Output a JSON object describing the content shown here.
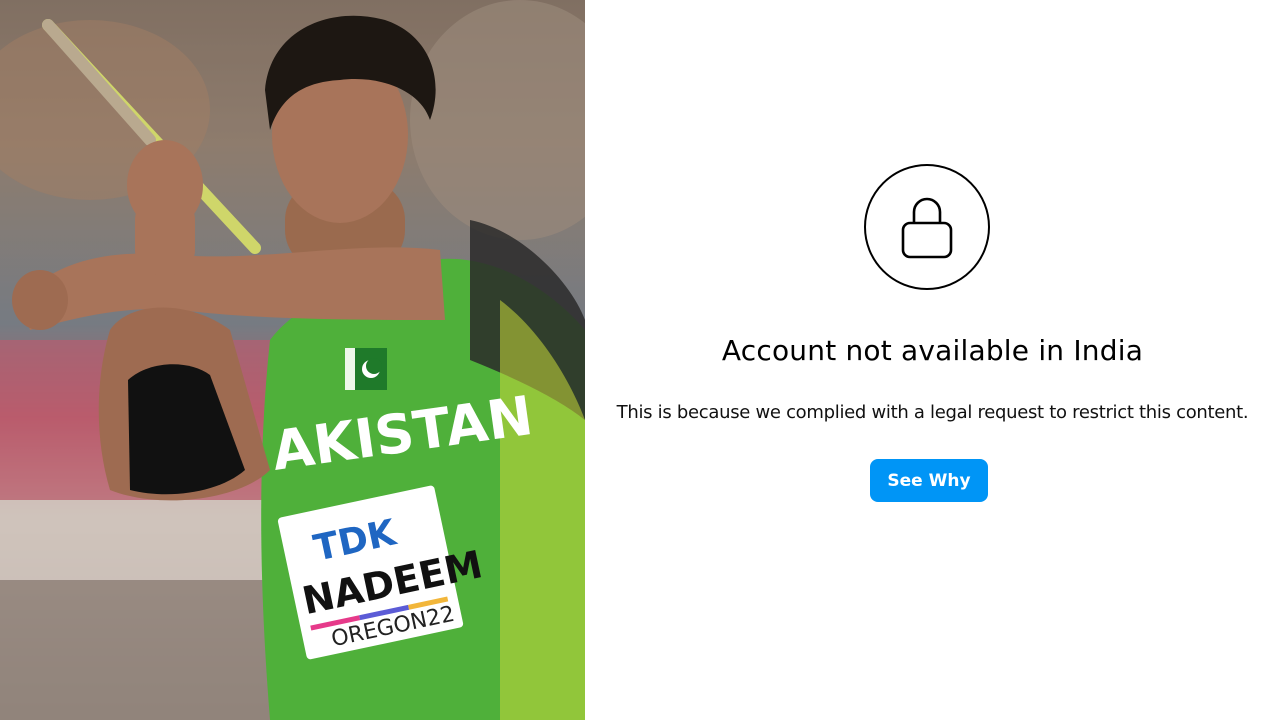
{
  "photo": {
    "jersey_text": "AKISTAN",
    "bib_sponsor": "TDK",
    "bib_name": "NADEEM",
    "bib_event": "OREGON22"
  },
  "notice": {
    "icon": "lock-icon",
    "title": "Account not available in India",
    "description": "This is because we complied with a legal request to restrict this content.",
    "button_label": "See Why"
  },
  "colors": {
    "button_bg": "#0095f6",
    "button_text": "#ffffff",
    "jersey_green": "#4fb03a"
  }
}
